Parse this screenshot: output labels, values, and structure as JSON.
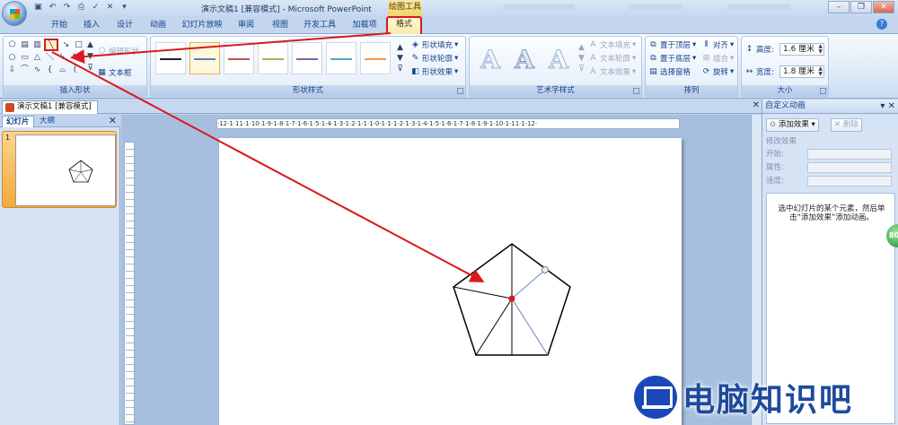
{
  "window": {
    "title": "演示文稿1 [兼容模式] - Microsoft PowerPoint",
    "context_tool_title": "绘图工具"
  },
  "tabs": [
    "开始",
    "插入",
    "设计",
    "动画",
    "幻灯片放映",
    "审阅",
    "视图",
    "开发工具",
    "加载项",
    "格式"
  ],
  "active_tab": "格式",
  "ribbon": {
    "insert_shapes": {
      "label": "插入形状",
      "edit_shape": "编辑形状",
      "textbox": "文本框"
    },
    "shape_styles": {
      "label": "形状样式",
      "fill": "形状填充",
      "outline": "形状轮廓",
      "effects": "形状效果"
    },
    "wordart_styles": {
      "label": "艺术字样式",
      "text_fill": "文本填充",
      "text_outline": "文本轮廓",
      "text_effects": "文本效果"
    },
    "arrange": {
      "label": "排列",
      "bring_front": "置于顶层",
      "send_back": "置于底层",
      "selection_pane": "选择窗格",
      "align": "对齐",
      "group": "组合",
      "rotate": "旋转"
    },
    "size": {
      "label": "大小",
      "height_label": "高度:",
      "height_value": "1.6 厘米",
      "width_label": "宽度:",
      "width_value": "1.8 厘米"
    }
  },
  "document_tab": "演示文稿1 [兼容模式]",
  "left_pane": {
    "tab_slides": "幻灯片",
    "tab_outline": "大纲",
    "slide_number": "1"
  },
  "ruler_text": "·12·1·11·1·10·1·9·1·8·1·7·1·6·1·5·1·4·1·3·1·2·1·1·1·0·1·1·1·2·1·3·1·4·1·5·1·6·1·7·1·8·1·9·1·10·1·11·1·12·",
  "task_pane": {
    "title": "自定义动画",
    "add_effect": "添加效果",
    "remove": "删除",
    "modify_label": "修改效果",
    "start_label": "开始:",
    "property_label": "属性:",
    "speed_label": "速度:",
    "message": "选中幻灯片的某个元素，然后单击“添加效果”添加动画。"
  },
  "badge_text": "80",
  "watermark": "电脑知识吧",
  "colors": {
    "annotation": "#d9191b",
    "ribbon_bg": "#dbe7f6",
    "format_tab": "#fbe8a8"
  }
}
